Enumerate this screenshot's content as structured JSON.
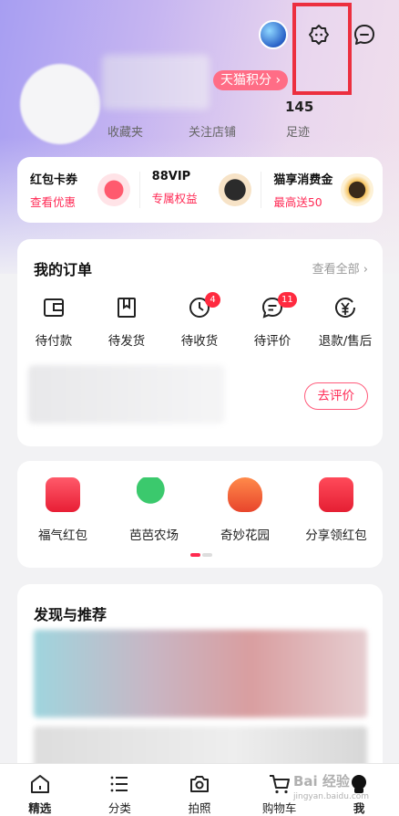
{
  "header": {
    "points_tag": "天猫积分 ›",
    "stats": [
      {
        "value": "",
        "label": "收藏夹"
      },
      {
        "value": "",
        "label": "关注店铺"
      },
      {
        "value": "145",
        "label": "足迹"
      }
    ]
  },
  "benefits": [
    {
      "title": "红包卡券",
      "sub": "查看优惠",
      "icon": "red-envelope-icon"
    },
    {
      "title": "88VIP",
      "sub": "专属权益",
      "icon": "vip-88-icon"
    },
    {
      "title": "猫享消费金",
      "sub": "最高送50",
      "icon": "cat-coin-icon"
    }
  ],
  "orders": {
    "title": "我的订单",
    "see_all": "查看全部 ›",
    "items": [
      {
        "label": "待付款",
        "badge": ""
      },
      {
        "label": "待发货",
        "badge": ""
      },
      {
        "label": "待收货",
        "badge": "4"
      },
      {
        "label": "待评价",
        "badge": "11"
      },
      {
        "label": "退款/售后",
        "badge": ""
      }
    ],
    "review_button": "去评价"
  },
  "services": [
    {
      "label": "福气红包",
      "color": "#f23a4d"
    },
    {
      "label": "芭芭农场",
      "color": "#2fba60"
    },
    {
      "label": "奇妙花园",
      "color": "#f06a3a"
    },
    {
      "label": "分享领红包",
      "color": "#ef2e3f"
    }
  ],
  "discover": {
    "title": "发现与推荐"
  },
  "tabbar": [
    {
      "label": "精选",
      "icon": "home-icon"
    },
    {
      "label": "分类",
      "icon": "list-icon"
    },
    {
      "label": "拍照",
      "icon": "camera-icon"
    },
    {
      "label": "购物车",
      "icon": "cart-icon"
    },
    {
      "label": "我",
      "icon": "profile-icon"
    }
  ],
  "watermark": {
    "main": "Bai 经验",
    "sub": "jingyan.baidu.com"
  }
}
